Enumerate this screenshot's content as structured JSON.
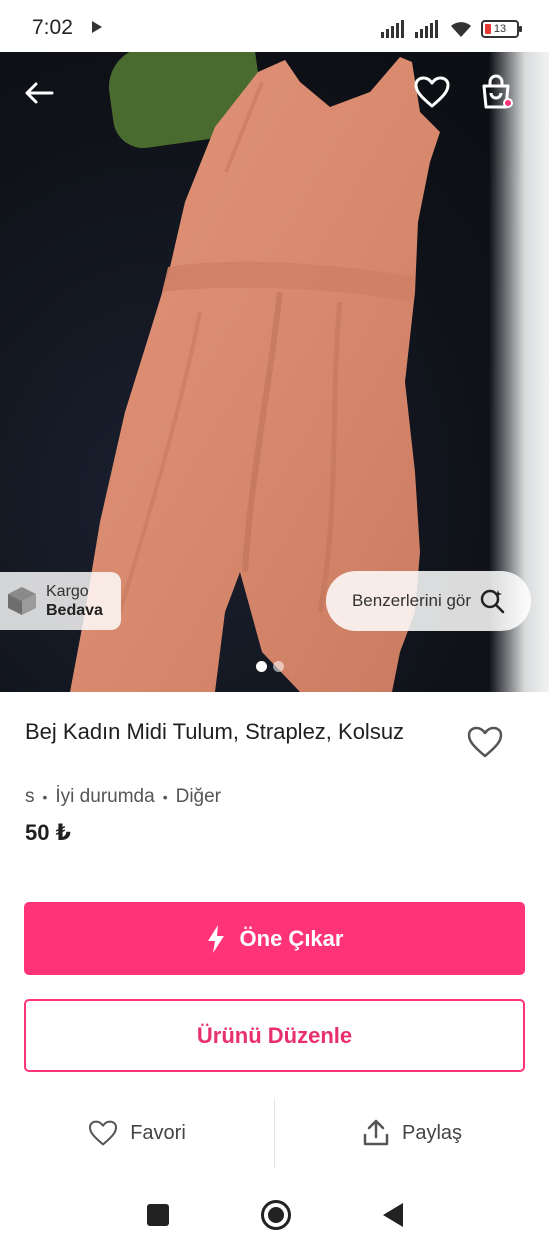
{
  "status_bar": {
    "time": "7:02",
    "battery": "13"
  },
  "hero": {
    "icons": {
      "back": "arrow-left-icon",
      "favorite": "heart-icon",
      "bag": "shopping-bag-icon"
    },
    "cargo_badge": {
      "line1": "Kargo",
      "line2": "Bedava"
    },
    "similar_button": {
      "label": "Benzerlerini gör"
    },
    "page_indicator": {
      "total": 2,
      "active": 1
    }
  },
  "product": {
    "title": "Bej Kadın Midi Tulum, Straplez, Kolsuz",
    "size": "s",
    "condition": "İyi durumda",
    "brand": "Diğer",
    "price": "50 ₺"
  },
  "buttons": {
    "promote_label": "Öne Çıkar",
    "edit_label": "Ürünü Düzenle"
  },
  "actions": {
    "favorite_label": "Favori",
    "share_label": "Paylaş"
  },
  "colors": {
    "accent": "#ff3377",
    "accent_text": "#e8306e"
  }
}
